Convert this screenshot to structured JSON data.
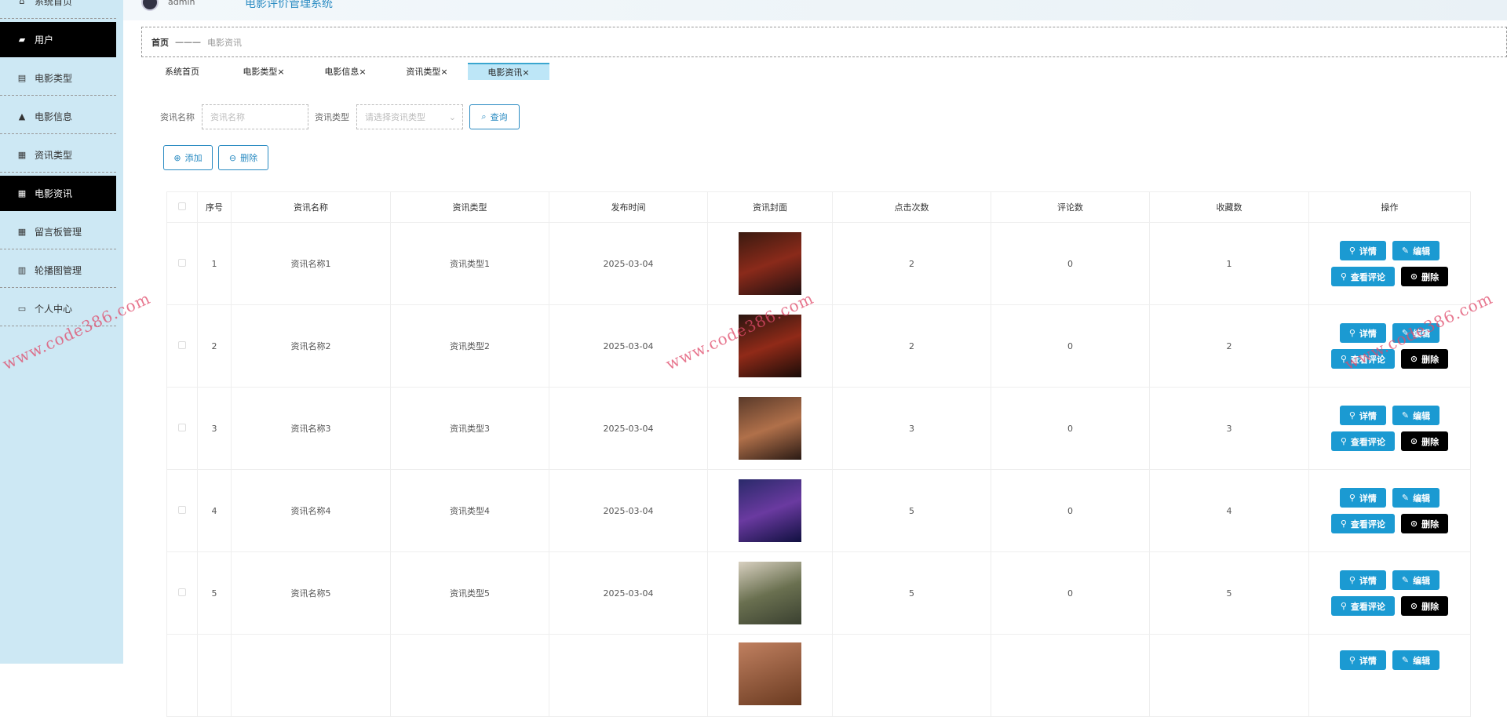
{
  "header": {
    "user": "admin",
    "title": "电影评价管理系统"
  },
  "sidebar": {
    "items": [
      {
        "label": "系统首页",
        "icon": "home-icon"
      },
      {
        "label": "用户",
        "icon": "briefcase-icon",
        "active": true
      },
      {
        "label": "电影类型",
        "icon": "clipboard-icon"
      },
      {
        "label": "电影信息",
        "icon": "user-icon"
      },
      {
        "label": "资讯类型",
        "icon": "grid-icon"
      },
      {
        "label": "电影资讯",
        "icon": "grid-icon",
        "active": true
      },
      {
        "label": "留言板管理",
        "icon": "grid-icon"
      },
      {
        "label": "轮播图管理",
        "icon": "bar-chart-icon"
      },
      {
        "label": "个人中心",
        "icon": "card-icon"
      }
    ]
  },
  "breadcrumb": {
    "home": "首页",
    "sep": "———",
    "current": "电影资讯"
  },
  "tabs": [
    {
      "label": "系统首页"
    },
    {
      "label": "电影类型×"
    },
    {
      "label": "电影信息×"
    },
    {
      "label": "资讯类型×"
    },
    {
      "label": "电影资讯×",
      "active": true
    }
  ],
  "search": {
    "name_label": "资讯名称",
    "name_placeholder": "资讯名称",
    "type_label": "资讯类型",
    "type_placeholder": "请选择资讯类型",
    "query": "查询"
  },
  "actions": {
    "add": "添加",
    "delete": "删除"
  },
  "table": {
    "headers": [
      "序号",
      "资讯名称",
      "资讯类型",
      "发布时间",
      "资讯封面",
      "点击次数",
      "评论数",
      "收藏数",
      "操作"
    ],
    "rows": [
      [
        "1",
        "资讯名称1",
        "资讯类型1",
        "2025-03-04",
        "2",
        "0",
        "1"
      ],
      [
        "2",
        "资讯名称2",
        "资讯类型2",
        "2025-03-04",
        "2",
        "0",
        "2"
      ],
      [
        "3",
        "资讯名称3",
        "资讯类型3",
        "2025-03-04",
        "3",
        "0",
        "3"
      ],
      [
        "4",
        "资讯名称4",
        "资讯类型4",
        "2025-03-04",
        "5",
        "0",
        "4"
      ],
      [
        "5",
        "资讯名称5",
        "资讯类型5",
        "2025-03-04",
        "5",
        "0",
        "5"
      ]
    ],
    "buttons": {
      "detail": "详情",
      "edit": "编辑",
      "comments": "查看评论",
      "delete": "删除"
    }
  },
  "watermark": "www.code386.com",
  "colors": {
    "accent": "#1b9ad2",
    "sidebar": "#cde8f4",
    "active": "#000000"
  }
}
